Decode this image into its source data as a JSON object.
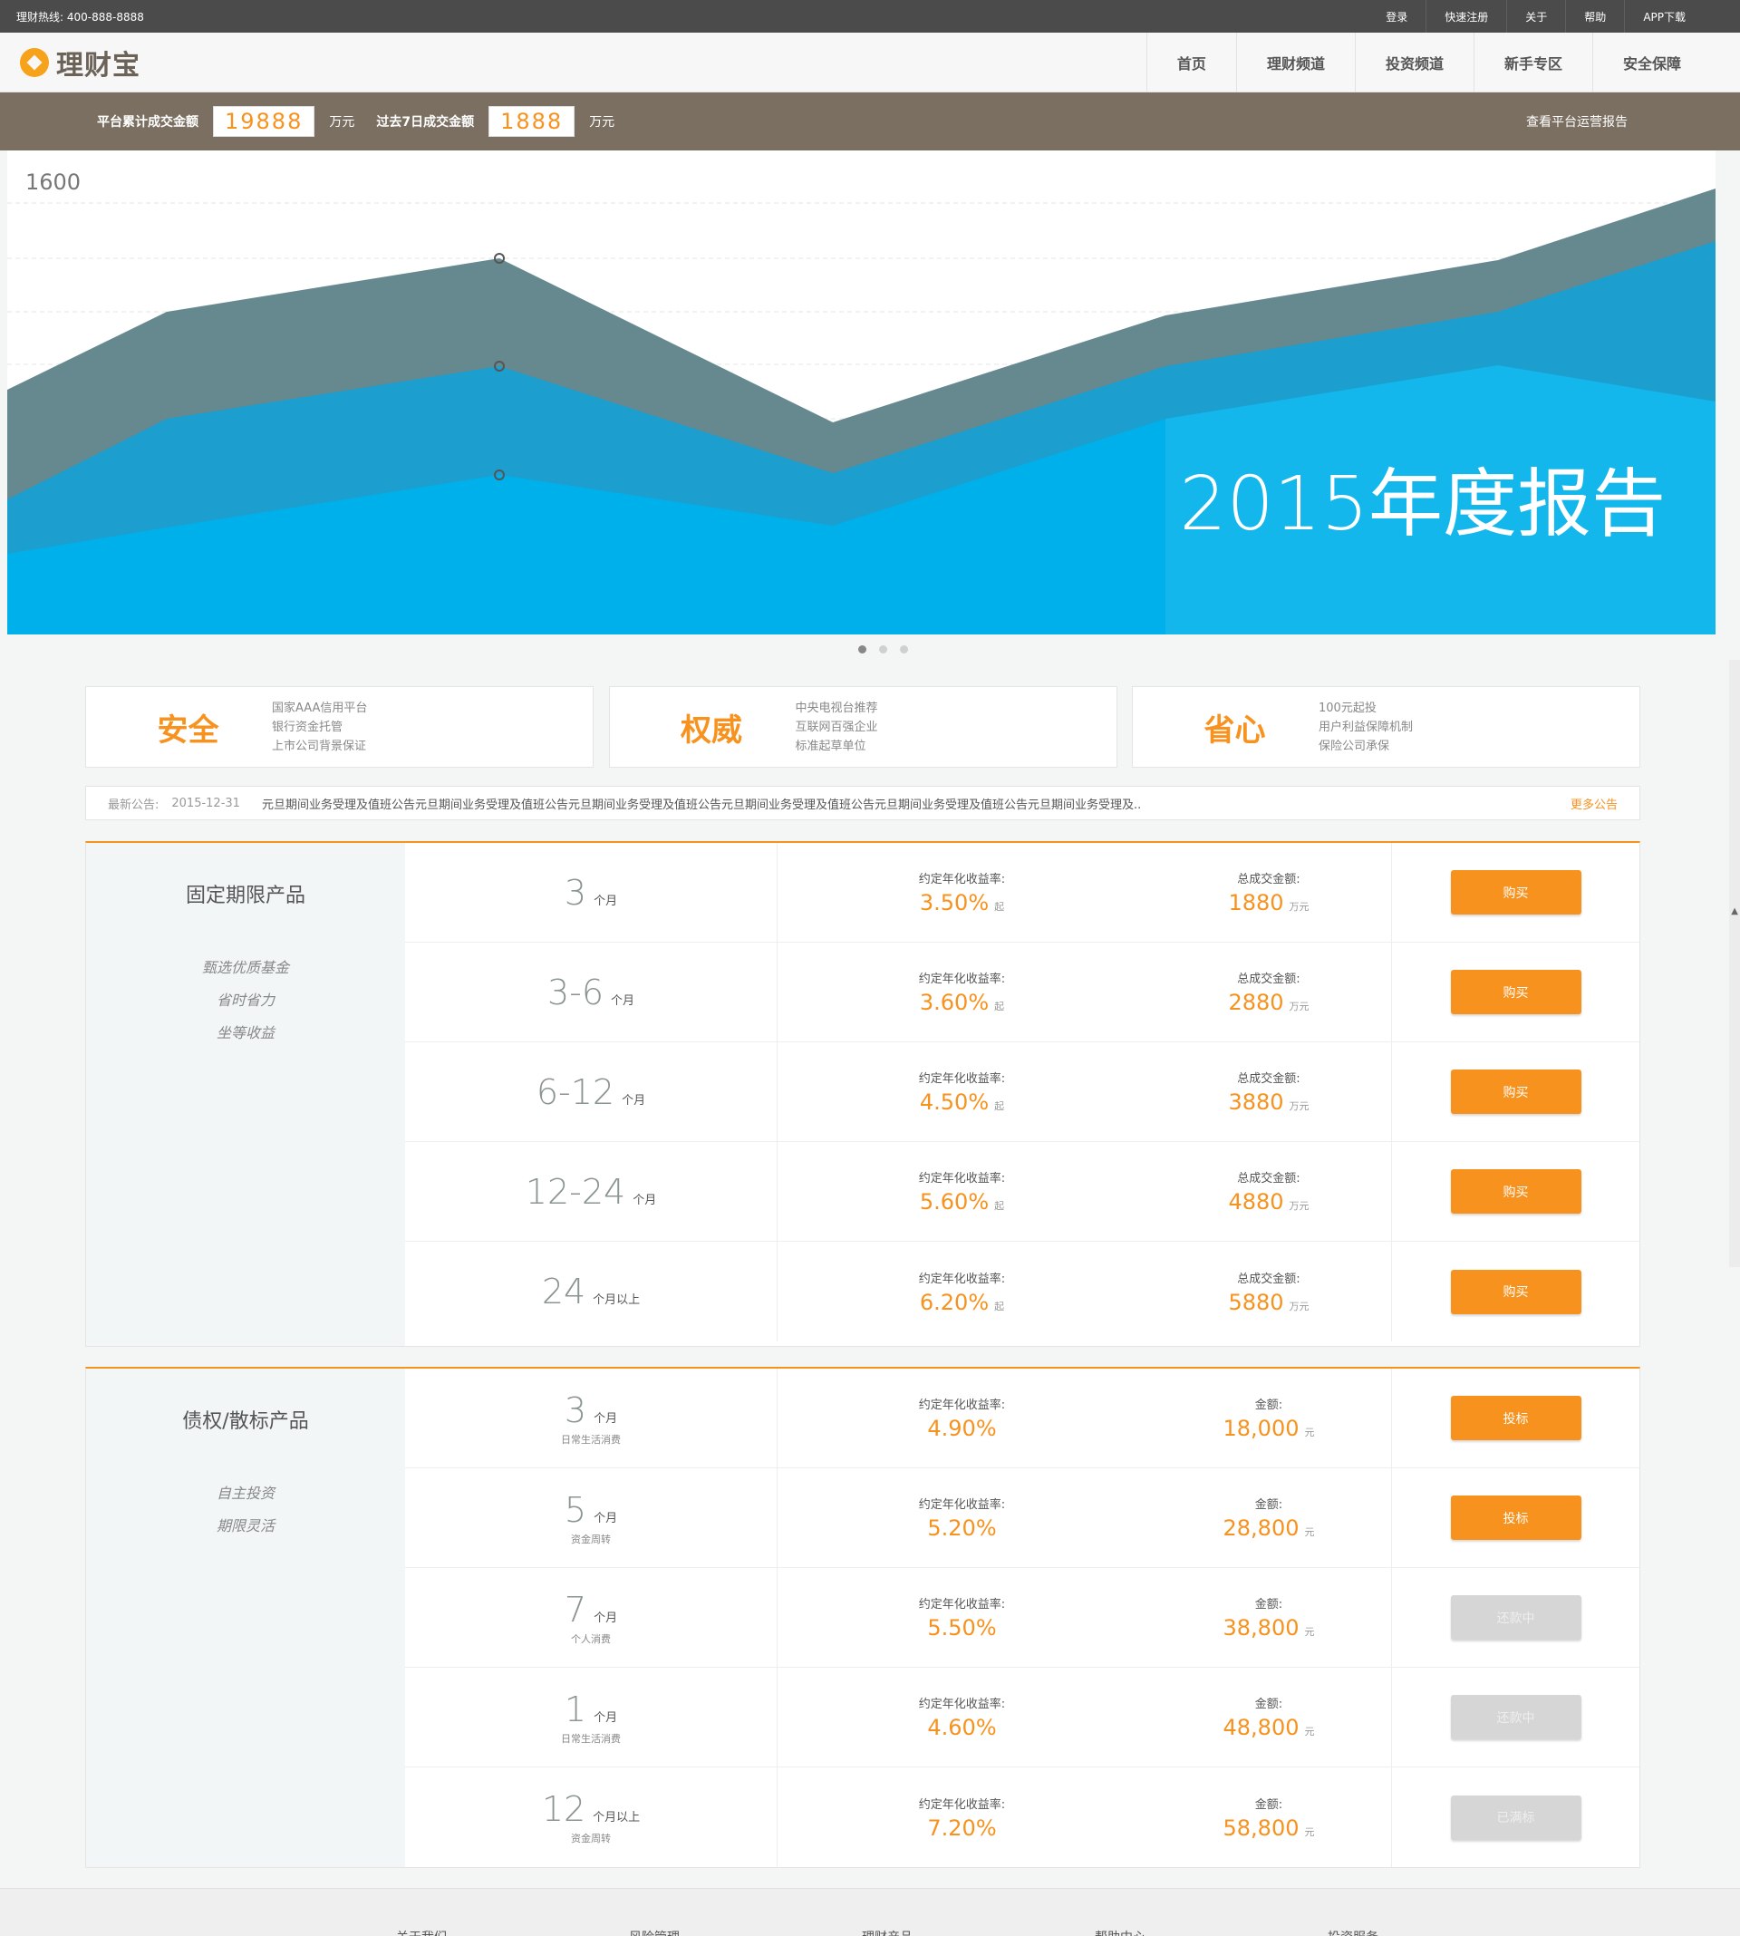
{
  "topbar": {
    "hotline": "理财热线: 400-888-8888",
    "links": [
      "登录",
      "快速注册",
      "关于",
      "帮助",
      "APP下载"
    ]
  },
  "brand": {
    "name": "理财宝",
    "color": "#f7a21b"
  },
  "nav": [
    "首页",
    "理财频道",
    "投资频道",
    "新手专区",
    "安全保障"
  ],
  "stats": {
    "total_label": "平台累计成交金额",
    "total_value": "19888",
    "total_unit": "万元",
    "week_label": "过去7日成交金额",
    "week_value": "1888",
    "week_unit": "万元",
    "report_link": "查看平台运营报告"
  },
  "banner": {
    "y_tick": "1600",
    "title": "2015年度报告",
    "colors": {
      "top": "#66888f",
      "mid": "#1c9ecf",
      "front": "#00b0eb"
    }
  },
  "carousel": {
    "count": 3,
    "active": 0
  },
  "features": [
    {
      "title": "安全",
      "lines": [
        "国家AAA信用平台",
        "银行资金托管",
        "上市公司背景保证"
      ]
    },
    {
      "title": "权威",
      "lines": [
        "中央电视台推荐",
        "互联网百强企业",
        "标准起草单位"
      ]
    },
    {
      "title": "省心",
      "lines": [
        "100元起投",
        "用户利益保障机制",
        "保险公司承保"
      ]
    }
  ],
  "notice": {
    "label": "最新公告:",
    "date": "2015-12-31",
    "text": "元旦期间业务受理及值班公告元旦期间业务受理及值班公告元旦期间业务受理及值班公告元旦期间业务受理及值班公告元旦期间业务受理及值班公告元旦期间业务受理及..",
    "more": "更多公告"
  },
  "fixed": {
    "title": "固定期限产品",
    "tags": [
      "甄选优质基金",
      "省时省力",
      "坐等收益"
    ],
    "rate_label": "约定年化收益率:",
    "amount_label": "总成交金额:",
    "rate_suffix": "起",
    "amount_unit": "万元",
    "rows": [
      {
        "term": "3",
        "term_unit": "个月",
        "rate": "3.50%",
        "amount": "1880",
        "button": "购买"
      },
      {
        "term": "3-6",
        "term_unit": "个月",
        "rate": "3.60%",
        "amount": "2880",
        "button": "购买"
      },
      {
        "term": "6-12",
        "term_unit": "个月",
        "rate": "4.50%",
        "amount": "3880",
        "button": "购买"
      },
      {
        "term": "12-24",
        "term_unit": "个月",
        "rate": "5.60%",
        "amount": "4880",
        "button": "购买"
      },
      {
        "term": "24",
        "term_unit": "个月以上",
        "rate": "6.20%",
        "amount": "5880",
        "button": "购买"
      }
    ]
  },
  "debt": {
    "title": "债权/散标产品",
    "tags": [
      "自主投资",
      "期限灵活"
    ],
    "rate_label": "约定年化收益率:",
    "amount_label": "金额:",
    "amount_unit": "元",
    "rows": [
      {
        "term": "3",
        "term_unit": "个月",
        "desc": "日常生活消费",
        "rate": "4.90%",
        "amount": "18,000",
        "button": "投标",
        "state": "active"
      },
      {
        "term": "5",
        "term_unit": "个月",
        "desc": "资金周转",
        "rate": "5.20%",
        "amount": "28,800",
        "button": "投标",
        "state": "active"
      },
      {
        "term": "7",
        "term_unit": "个月",
        "desc": "个人消费",
        "rate": "5.50%",
        "amount": "38,800",
        "button": "还款中",
        "state": "disabled"
      },
      {
        "term": "1",
        "term_unit": "个月",
        "desc": "日常生活消费",
        "rate": "4.60%",
        "amount": "48,800",
        "button": "还款中",
        "state": "disabled"
      },
      {
        "term": "12",
        "term_unit": "个月以上",
        "desc": "资金周转",
        "rate": "7.20%",
        "amount": "58,800",
        "button": "已满标",
        "state": "disabled"
      }
    ]
  },
  "footer": {
    "links": [
      "关于我们",
      "风险管理",
      "理财产品",
      "帮助中心",
      "投资服务"
    ]
  }
}
